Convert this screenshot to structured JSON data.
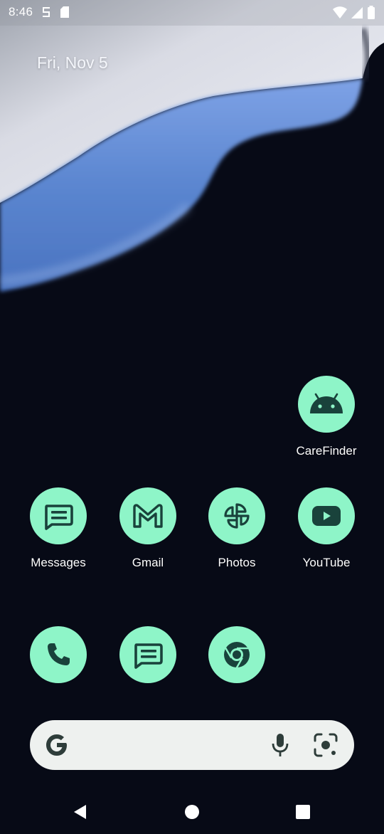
{
  "colors": {
    "background": "#070a16",
    "icon_bg": "#8ef5c8",
    "icon_fg": "#19423b",
    "search_bg": "#eef1ef",
    "search_icon": "#2e3d3a",
    "text": "#ffffff"
  },
  "status_bar": {
    "time": "8:46",
    "left_icons": [
      "s-icon",
      "sd-card-icon"
    ],
    "right_icons": [
      "wifi-icon",
      "signal-icon",
      "battery-icon"
    ]
  },
  "date_widget": {
    "text": "Fri, Nov 5"
  },
  "apps": {
    "carefinder": {
      "label": "CareFinder",
      "icon": "android-icon"
    },
    "messages": {
      "label": "Messages",
      "icon": "messages-icon"
    },
    "gmail": {
      "label": "Gmail",
      "icon": "gmail-icon"
    },
    "photos": {
      "label": "Photos",
      "icon": "photos-icon"
    },
    "youtube": {
      "label": "YouTube",
      "icon": "youtube-icon"
    }
  },
  "dock": [
    {
      "icon": "phone-icon"
    },
    {
      "icon": "messages-icon"
    },
    {
      "icon": "chrome-icon"
    }
  ],
  "search_bar": {
    "icons": [
      "google-g-icon",
      "mic-icon",
      "lens-icon"
    ]
  },
  "nav_bar": {
    "buttons": [
      "back-icon",
      "home-icon",
      "recents-icon"
    ]
  }
}
